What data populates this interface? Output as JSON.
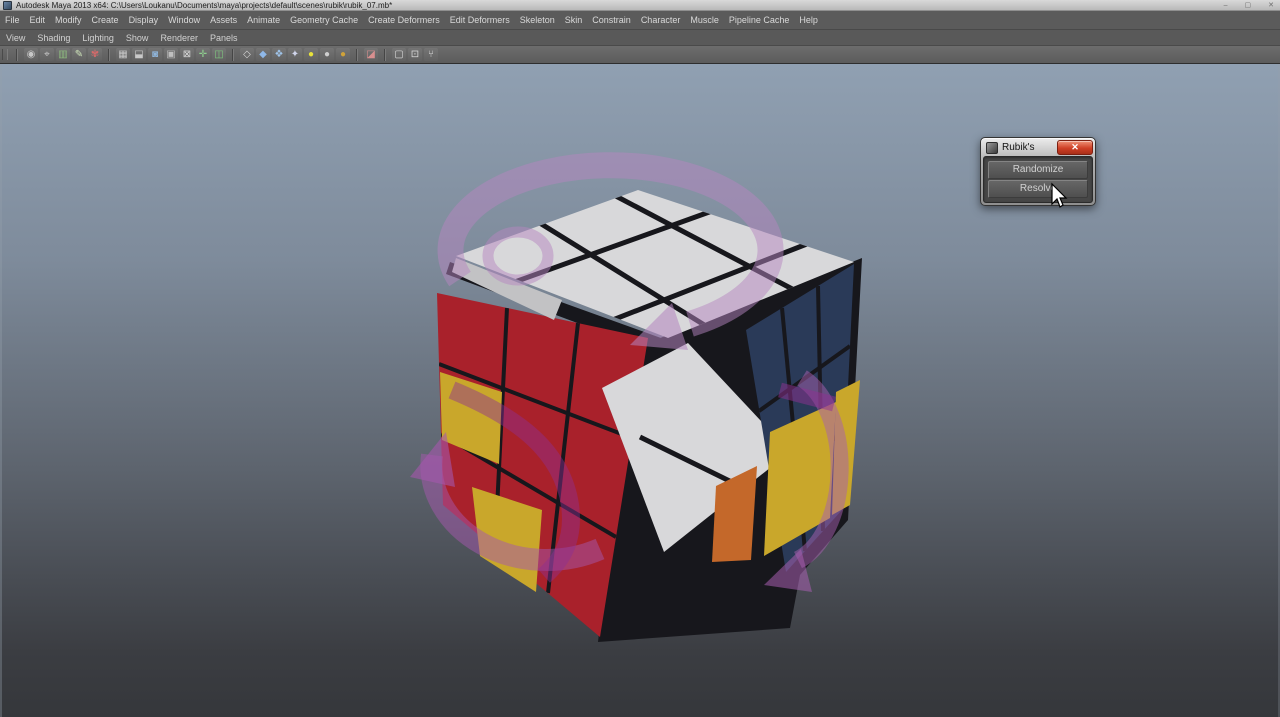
{
  "title_bar": {
    "app_title": "Autodesk Maya 2013 x64: C:\\Users\\Loukanu\\Documents\\maya\\projects\\default\\scenes\\rubik\\rubik_07.mb*",
    "controls": {
      "minimize": "–",
      "maximize": "▢",
      "close": "✕"
    }
  },
  "menu_bar": {
    "items": [
      "File",
      "Edit",
      "Modify",
      "Create",
      "Display",
      "Window",
      "Assets",
      "Animate",
      "Geometry Cache",
      "Create Deformers",
      "Edit Deformers",
      "Skeleton",
      "Skin",
      "Constrain",
      "Character",
      "Muscle",
      "Pipeline Cache",
      "Help"
    ]
  },
  "panel_menu": {
    "items": [
      "View",
      "Shading",
      "Lighting",
      "Show",
      "Renderer",
      "Panels"
    ]
  },
  "toolbar": {
    "groups": [
      {
        "icons": [
          {
            "name": "camera-icon",
            "glyph": "◉",
            "color": "#c8c8c8"
          },
          {
            "name": "camera-aim-icon",
            "glyph": "⌖",
            "color": "#c8c8c8"
          },
          {
            "name": "image-plane-icon",
            "glyph": "▥",
            "color": "#8fbf7f"
          },
          {
            "name": "grease-pencil-icon",
            "glyph": "✎",
            "color": "#cde2b8"
          },
          {
            "name": "camera-bookmark-icon",
            "glyph": "✾",
            "color": "#d46a6a"
          }
        ]
      },
      {
        "icons": [
          {
            "name": "grid-icon",
            "glyph": "▦",
            "color": "#c9c9c9"
          },
          {
            "name": "film-gate-icon",
            "glyph": "⬓",
            "color": "#c9c9c9"
          },
          {
            "name": "resolution-gate-icon",
            "glyph": "◙",
            "color": "#8fb4d9"
          },
          {
            "name": "gate-mask-icon",
            "glyph": "▣",
            "color": "#bfbfbf"
          },
          {
            "name": "field-chart-icon",
            "glyph": "⊠",
            "color": "#d9d9d9"
          },
          {
            "name": "safe-action-icon",
            "glyph": "✛",
            "color": "#8fd08f"
          },
          {
            "name": "safe-title-icon",
            "glyph": "◫",
            "color": "#7fc97f"
          }
        ]
      },
      {
        "icons": [
          {
            "name": "wireframe-icon",
            "glyph": "◇",
            "color": "#d9d9d9"
          },
          {
            "name": "smooth-shade-icon",
            "glyph": "◆",
            "color": "#8fb8e8"
          },
          {
            "name": "textured-icon",
            "glyph": "❖",
            "color": "#9fc4ea"
          },
          {
            "name": "use-all-lights-icon",
            "glyph": "✦",
            "color": "#cfd4ea"
          },
          {
            "name": "default-light-icon",
            "glyph": "●",
            "color": "#e8e23a"
          },
          {
            "name": "flat-light-icon",
            "glyph": "●",
            "color": "#cfcfcf"
          },
          {
            "name": "ambient-light-icon",
            "glyph": "●",
            "color": "#cfa23a"
          }
        ]
      },
      {
        "icons": [
          {
            "name": "isolate-select-icon",
            "glyph": "◪",
            "color": "#d98f8f"
          }
        ]
      },
      {
        "icons": [
          {
            "name": "xray-icon",
            "glyph": "▢",
            "color": "#d9d9d9"
          },
          {
            "name": "xray-joints-icon",
            "glyph": "⊡",
            "color": "#d9d9d9"
          },
          {
            "name": "plugin-display-icon",
            "glyph": "⑂",
            "color": "#d9d9d9"
          }
        ]
      }
    ]
  },
  "rubiks_window": {
    "title": "Rubik's",
    "close_label": "✕",
    "buttons": [
      {
        "label": "Randomize"
      },
      {
        "label": "Resolve"
      }
    ]
  },
  "viewport": {
    "scene_objects": [
      "rubiks-cube",
      "rotation-manipulator-arrows"
    ]
  },
  "colors": {
    "cube_red": "#a9212b",
    "cube_white": "#d8d8da",
    "cube_blue": "#2a3a58",
    "cube_yellow": "#c9a72b",
    "cube_orange": "#c4682a",
    "arrow_purple": "#b585c0",
    "arrow_magenta": "#8f2f92",
    "viewport_top": "#90a0b2",
    "viewport_bottom": "#35373b",
    "close_red": "#cf4026"
  }
}
